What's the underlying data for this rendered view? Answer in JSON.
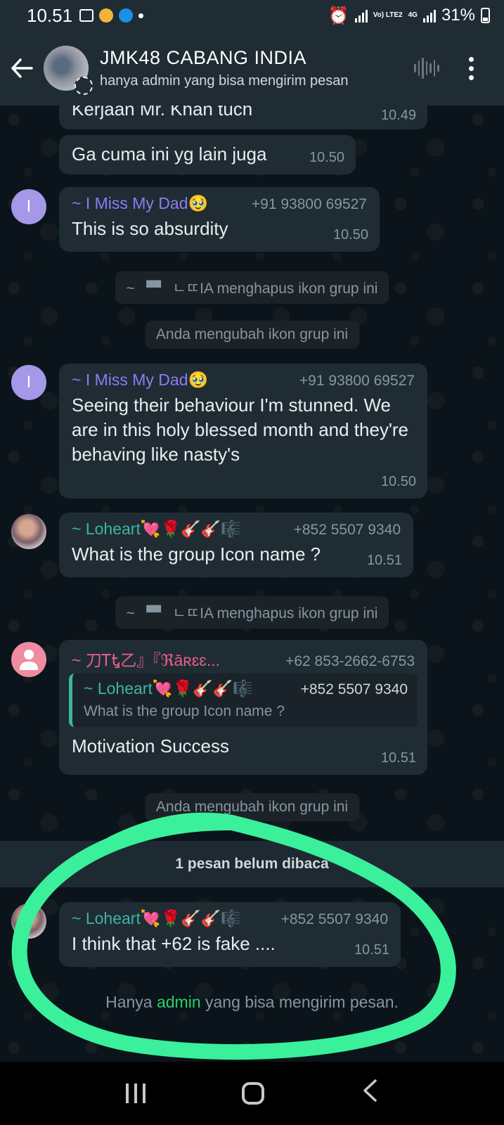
{
  "status_bar": {
    "time": "10.51",
    "network": "Vo) LTE2",
    "network_gen": "4G",
    "battery": "31%"
  },
  "header": {
    "back_icon": "back-arrow-icon",
    "title": "JMK48 CABANG INDIA",
    "subtitle": "hanya admin yang bisa mengirim pesan"
  },
  "messages": {
    "m1": {
      "text": "Kerjaan Mr. Khan tuch",
      "time": "10.49"
    },
    "m2": {
      "text": "Ga cuma ini yg lain juga",
      "time": "10.50"
    },
    "m3": {
      "avatar_letter": "I",
      "sender": "~ I Miss My Dad🥹",
      "phone": "+91 93800 69527",
      "text": "This is so absurdity",
      "time": "10.50"
    },
    "s1": {
      "icon": "▚▘",
      "text": "~ ▝▘ ㄴㄸIA menghapus ikon grup ini"
    },
    "s2": {
      "text": "Anda mengubah ikon grup ini"
    },
    "m4": {
      "avatar_letter": "I",
      "sender": "~ I Miss My Dad🥹",
      "phone": "+91 93800 69527",
      "text": "Seeing their behaviour I'm stunned. We are in this holy blessed month and they're behaving like nasty's",
      "time": "10.50"
    },
    "m5": {
      "sender": "~ Loheart💘🌹🎸🎸🎼",
      "phone": "+852 5507 9340",
      "text": "What is the group Icon name ?",
      "time": "10.51"
    },
    "s3": {
      "text": "~ ▝▘ ㄴㄸIA menghapus ikon grup ini"
    },
    "m6": {
      "sender": "~ 刀ᎢᎿ乙』『ℜāʀɛɛ...",
      "phone": "+62 853-2662-6753",
      "quote_sender": "~ Loheart💘🌹🎸🎸🎼",
      "quote_phone": "+852 5507 9340",
      "quote_text": "What is the group Icon name ?",
      "text": "Motivation Success",
      "time": "10.51"
    },
    "s4": {
      "text": "Anda mengubah ikon grup ini"
    },
    "unread": "1 pesan belum dibaca",
    "m7": {
      "sender": "~ Loheart💘🌹🎸🎸🎼",
      "phone": "+852 5507 9340",
      "text": "I think that +62 is fake ....",
      "time": "10.51"
    }
  },
  "admin_notice": {
    "before": "Hanya ",
    "link": "admin",
    "after": " yang bisa mengirim pesan."
  },
  "colors": {
    "header_bg": "#1f2c34",
    "chat_bg": "#0b141a",
    "bubble_bg": "#202c33",
    "highlight": "#3af09a",
    "accent_green": "#25d366"
  }
}
